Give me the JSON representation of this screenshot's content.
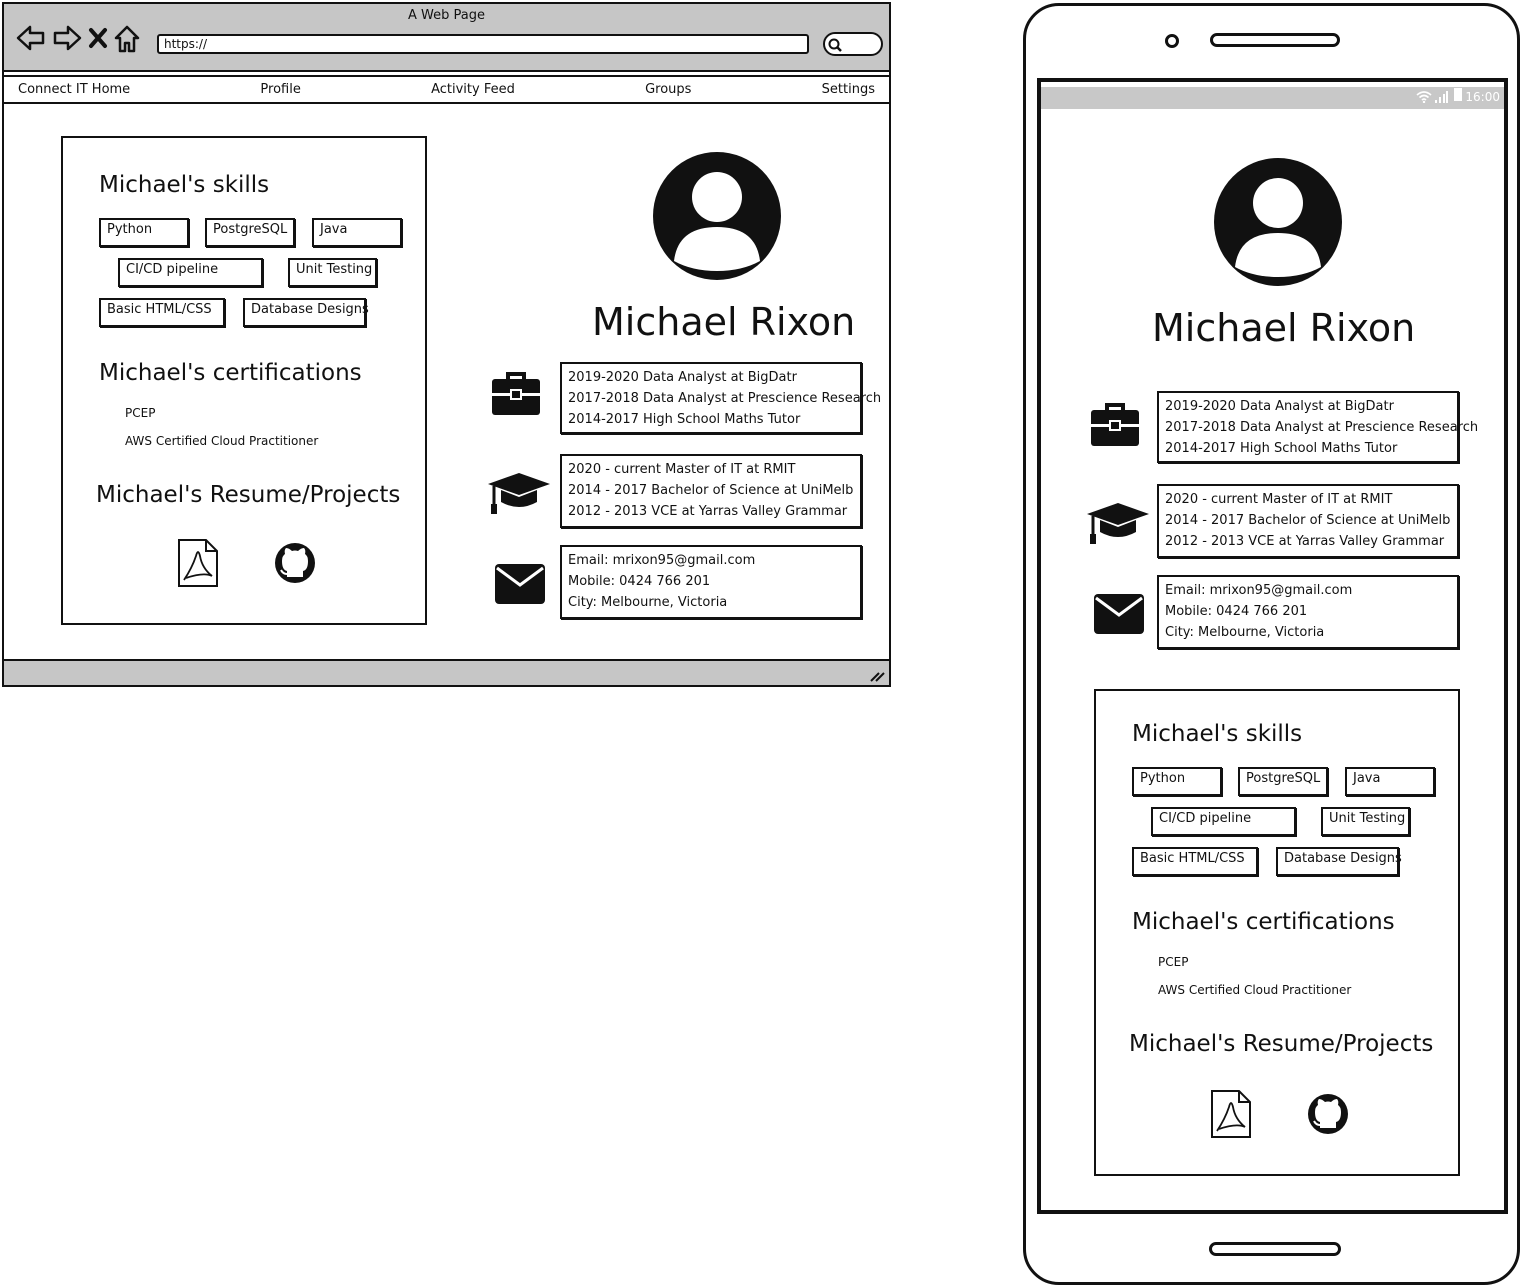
{
  "browser": {
    "window_title": "A Web Page",
    "url": "https://",
    "menu": [
      "Connect IT Home",
      "Profile",
      "Activity Feed",
      "Groups",
      "Settings"
    ]
  },
  "profile": {
    "name": "Michael Rixon",
    "skills_title": "Michael's skills",
    "skills": [
      "Python",
      "PostgreSQL",
      "Java",
      "CI/CD pipeline",
      "Unit Testing",
      "Basic HTML/CSS",
      "Database Designs"
    ],
    "certs_title": "Michael's certifications",
    "certs": [
      "PCEP",
      "AWS Certified Cloud Practitioner"
    ],
    "resume_title": "Michael's Resume/Projects",
    "work": [
      "2019-2020  Data Analyst at BigDatr",
      "2017-2018  Data Analyst at Prescience Research",
      "2014-2017  High School Maths Tutor"
    ],
    "education": [
      "2020 - current  Master of IT at RMIT",
      "2014 - 2017  Bachelor of Science at UniMelb",
      "2012 - 2013  VCE at Yarras Valley Grammar"
    ],
    "contact": [
      "Email:  mrixon95@gmail.com",
      "Mobile:  0424 766 201",
      "City:  Melbourne, Victoria"
    ]
  },
  "phone": {
    "clock": "16:00"
  },
  "icons": {
    "back": "arrow-left-icon",
    "forward": "arrow-right-icon",
    "stop": "close-icon",
    "home": "home-icon",
    "search": "search-icon",
    "work": "briefcase-icon",
    "education": "graduation-cap-icon",
    "contact": "envelope-icon",
    "resume": "pdf-file-icon",
    "projects": "github-icon",
    "avatar": "user-avatar-icon"
  }
}
